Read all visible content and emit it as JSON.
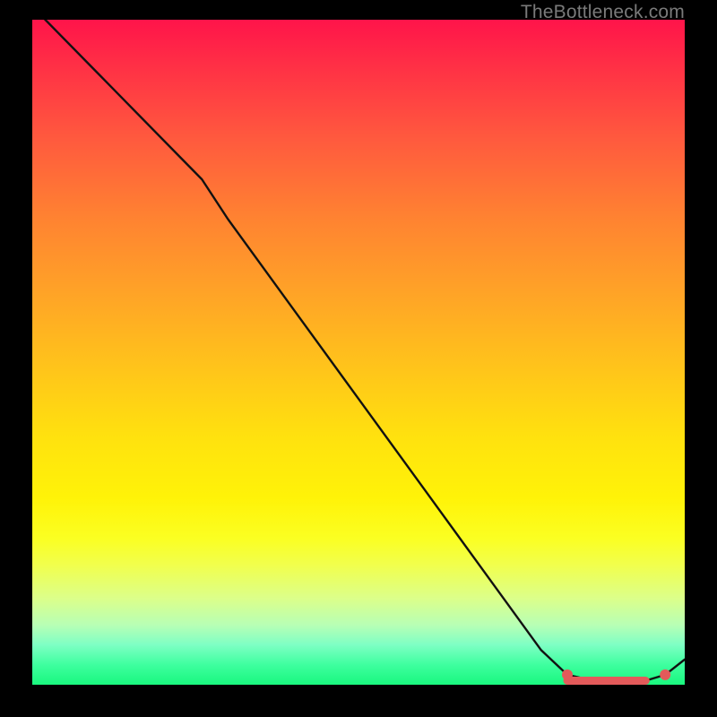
{
  "attribution": "TheBottleneck.com",
  "colors": {
    "curve_stroke": "#111111",
    "marker_stroke": "#e35a5a",
    "marker_fill": "#e35a5a",
    "background": "#000000"
  },
  "chart_data": {
    "type": "line",
    "title": "",
    "xlabel": "",
    "ylabel": "",
    "xlim": [
      0,
      100
    ],
    "ylim": [
      0,
      100
    ],
    "grid": false,
    "legend": false,
    "series": [
      {
        "name": "curve",
        "x": [
          0,
          10,
          20,
          26,
          30,
          40,
          50,
          60,
          70,
          78,
          82,
          86,
          90,
          94,
          97,
          100
        ],
        "y": [
          102,
          92,
          82,
          76,
          70,
          56.5,
          43,
          29.5,
          16,
          5.2,
          1.5,
          0.6,
          0.6,
          0.6,
          1.5,
          3.8
        ]
      }
    ],
    "markers": [
      {
        "name": "flat-segment-start",
        "x": 82,
        "y": 1.5,
        "shape": "dot"
      },
      {
        "name": "flat-segment-track",
        "x_range": [
          82,
          94
        ],
        "y": 0.6,
        "shape": "thick-line"
      },
      {
        "name": "right-dot",
        "x": 97,
        "y": 1.5,
        "shape": "dot"
      }
    ]
  }
}
